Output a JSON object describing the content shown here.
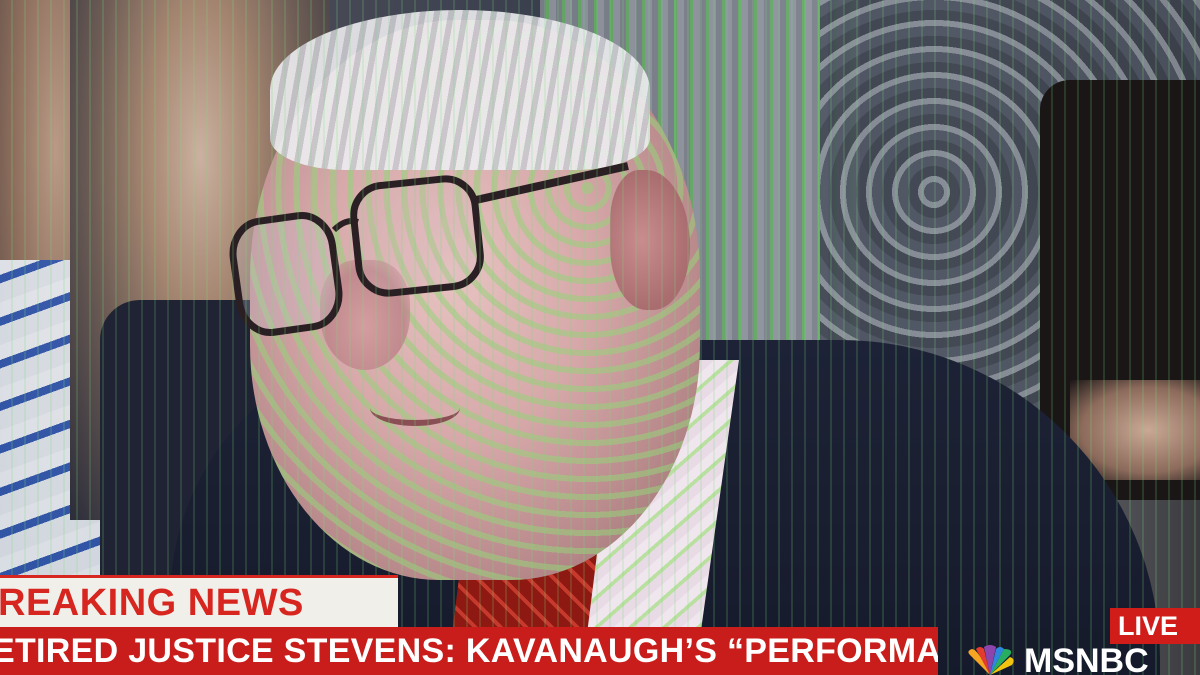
{
  "chyron": {
    "breaking_label": "REAKING NEWS",
    "headline": "ETIRED JUSTICE STEVENS: KAVANAUGH’S “PERFORMANCE"
  },
  "badge": {
    "live_label": "LIVE"
  },
  "network": {
    "name": "MSNBC",
    "logo_icon": "peacock-icon"
  },
  "colors": {
    "breaking_red": "#d7261f",
    "headline_red": "#c81d1a",
    "live_red": "#d11d1a"
  }
}
